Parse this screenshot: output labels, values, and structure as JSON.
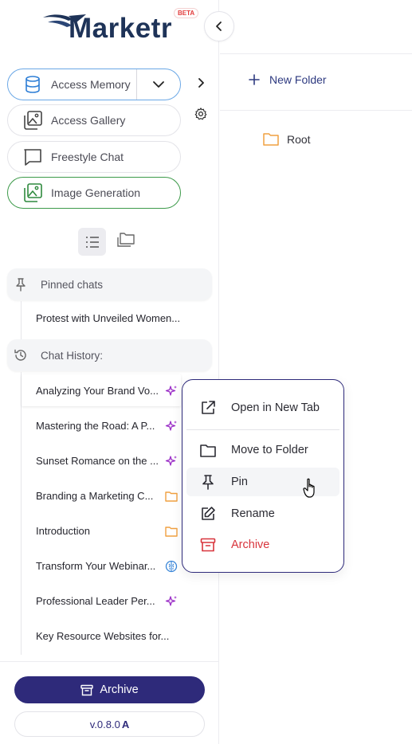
{
  "app": {
    "logo_text": "Marketr",
    "beta_label": "BETA"
  },
  "sidebar": {
    "tools": [
      {
        "label": "Access Memory",
        "icon": "database-icon"
      },
      {
        "label": "Access Gallery",
        "icon": "gallery-icon"
      },
      {
        "label": "Freestyle Chat",
        "icon": "chat-bubble-icon"
      },
      {
        "label": "Image Generation",
        "icon": "image-icon"
      }
    ],
    "pinned": {
      "title": "Pinned chats",
      "items": [
        "Protest with Unveiled Women..."
      ]
    },
    "history": {
      "title": "Chat History:",
      "items": [
        {
          "label": "Analyzing Your Brand Vo...",
          "icon": "sparkles-icon"
        },
        {
          "label": "Mastering the Road: A P...",
          "icon": "sparkles-icon"
        },
        {
          "label": "Sunset Romance on the ...",
          "icon": "sparkles-icon"
        },
        {
          "label": "Branding a Marketing C...",
          "icon": "folder-icon"
        },
        {
          "label": "Introduction",
          "icon": "folder-icon"
        },
        {
          "label": "Transform Your Webinar...",
          "icon": "brain-icon"
        },
        {
          "label": "Professional Leader Per...",
          "icon": "sparkles-icon"
        },
        {
          "label": "Key Resource Websites for...",
          "icon": ""
        }
      ]
    },
    "archive_label": "Archive",
    "version": "v.0.8.0",
    "version_suffix": "A"
  },
  "main": {
    "new_folder_label": "New Folder",
    "root_label": "Root"
  },
  "context_menu": {
    "items": [
      {
        "label": "Open in New Tab",
        "icon": "external-link-icon"
      },
      {
        "label": "Move to Folder",
        "icon": "folder-icon"
      },
      {
        "label": "Pin",
        "icon": "pin-icon"
      },
      {
        "label": "Rename",
        "icon": "edit-icon"
      },
      {
        "label": "Archive",
        "icon": "archive-icon"
      }
    ]
  },
  "colors": {
    "brand": "#2e2a7a",
    "memory_border": "#6aa7e6",
    "imagegen_border": "#3d9a4a",
    "sparkle": "#9b2fc7",
    "folder": "#f0a040",
    "brain": "#3a86d8",
    "danger": "#d8343c"
  }
}
